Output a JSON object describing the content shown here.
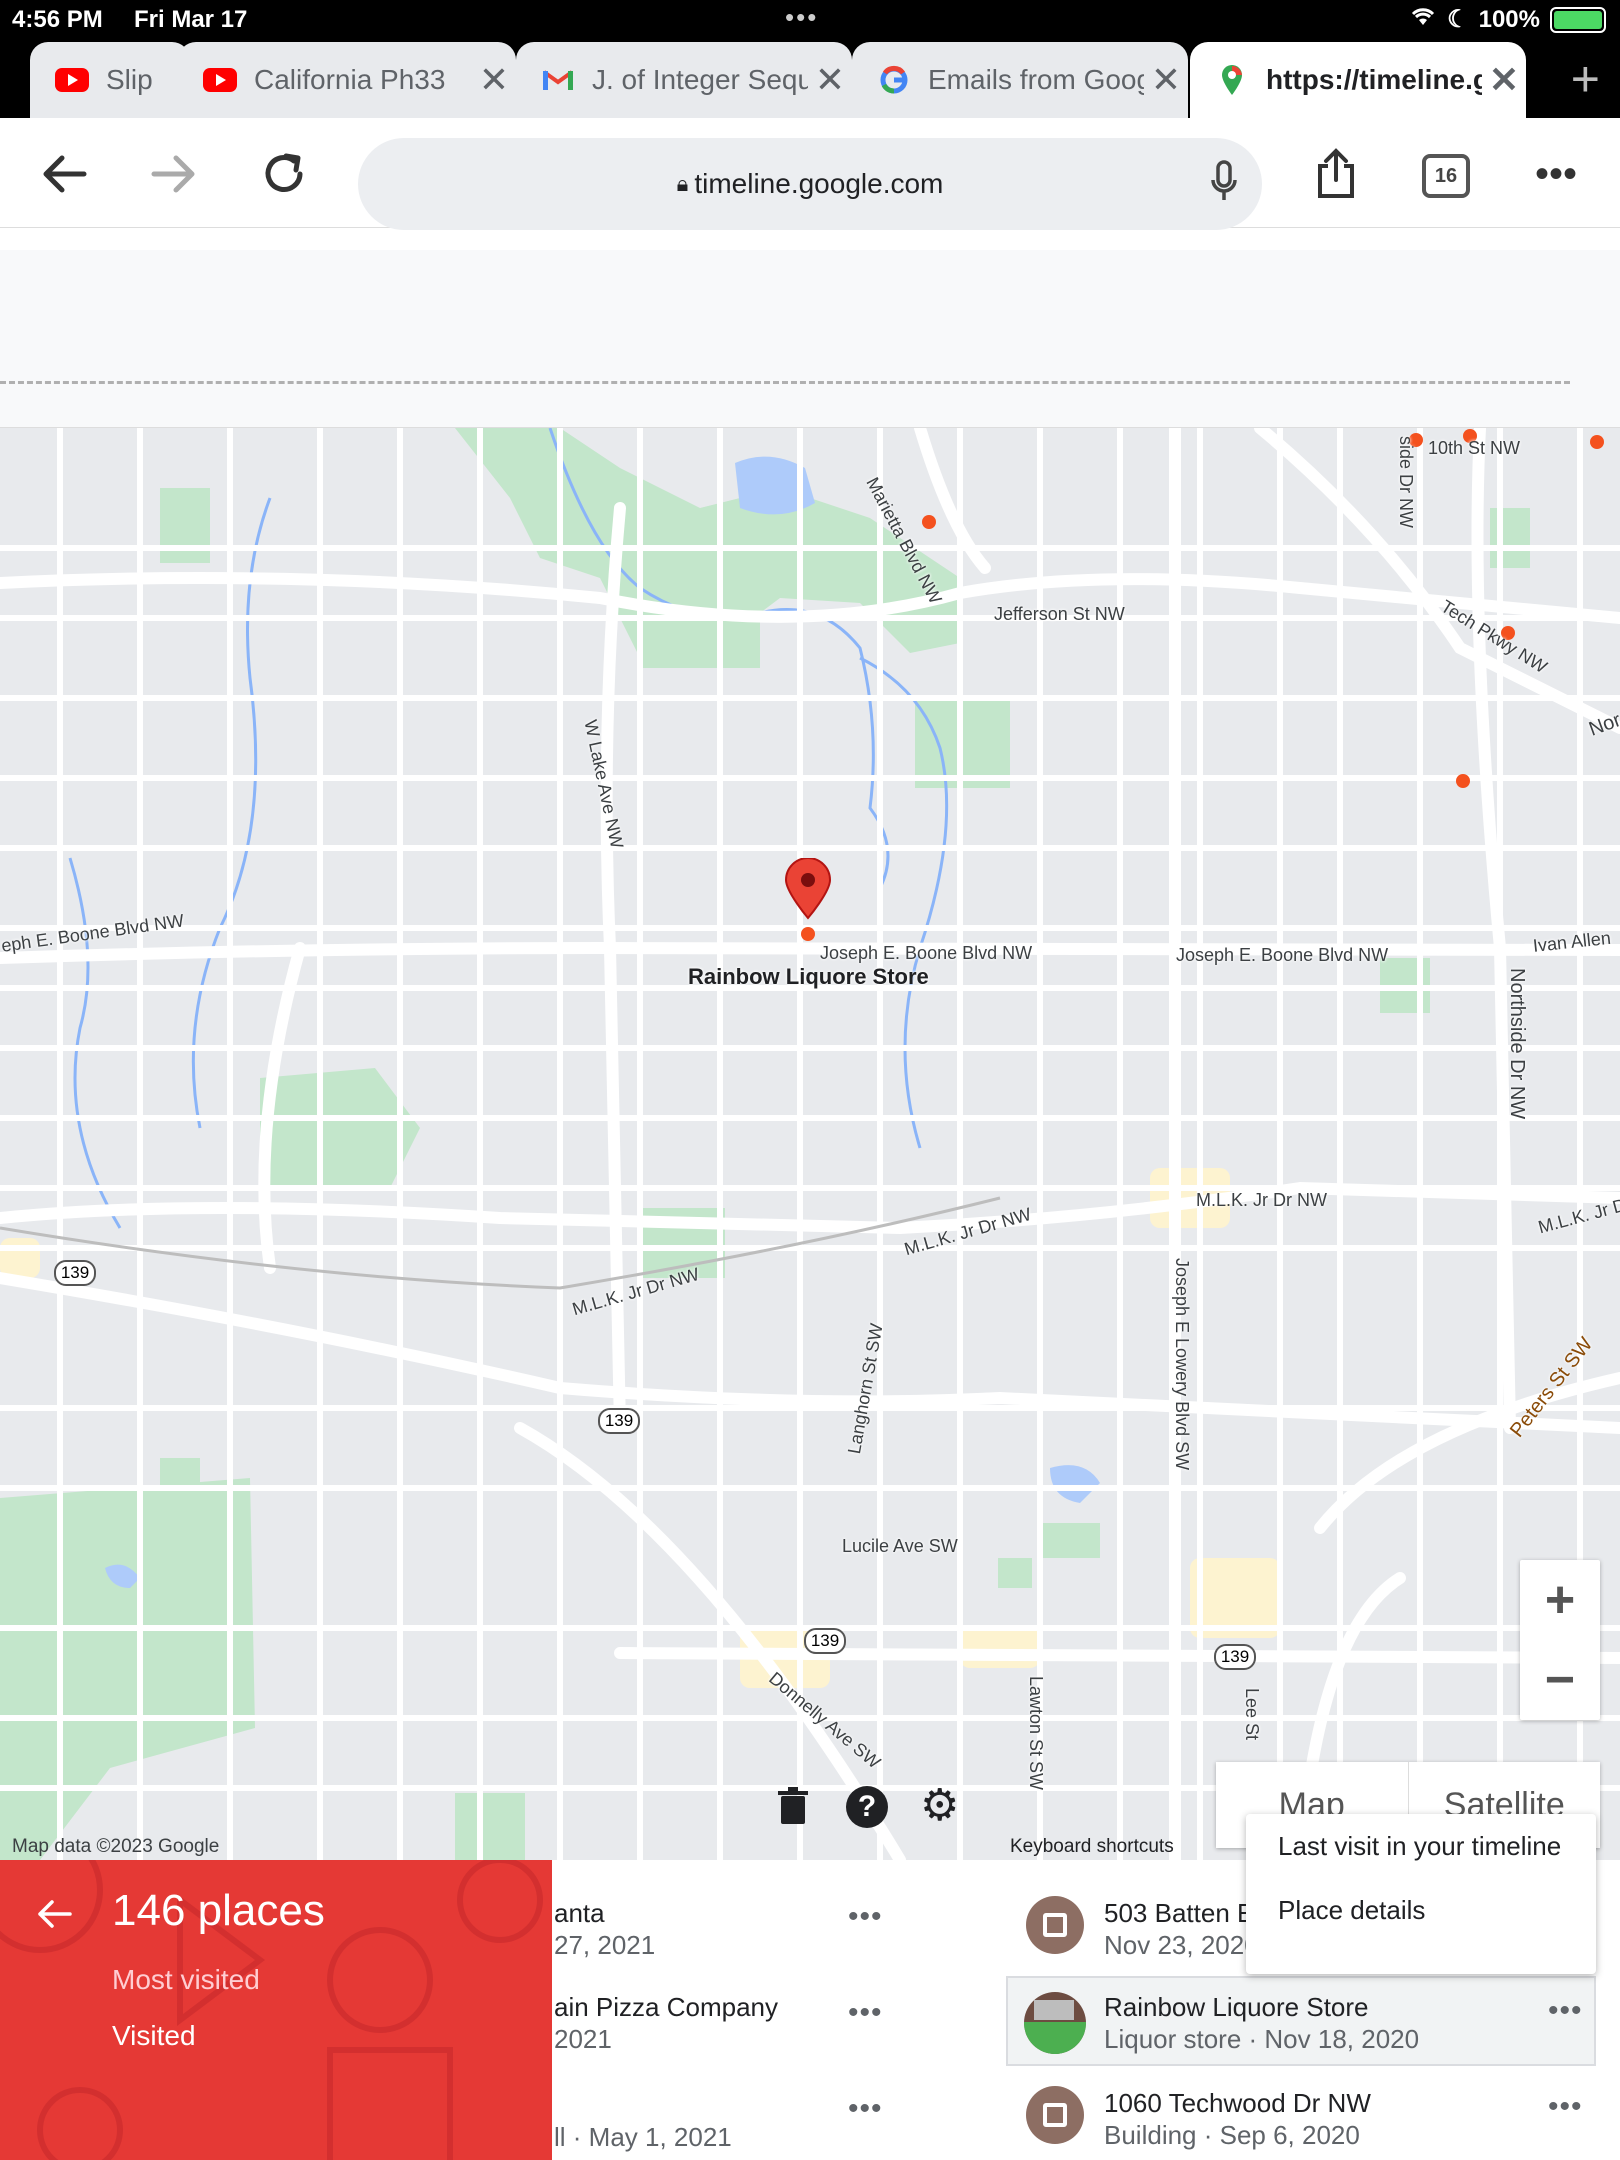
{
  "status_bar": {
    "time": "4:56 PM",
    "date": "Fri Mar 17",
    "battery": "100%"
  },
  "tabs": [
    {
      "title": "Slip",
      "icon": "youtube-icon"
    },
    {
      "title": "California Ph33",
      "icon": "youtube-icon"
    },
    {
      "title": "J. of Integer Sequences",
      "icon": "gmail-icon"
    },
    {
      "title": "Emails from Google",
      "icon": "google-icon"
    },
    {
      "title": "https://timeline.google.com",
      "icon": "maps-pin-icon"
    }
  ],
  "toolbar": {
    "url": "timeline.google.com",
    "tab_count": "16"
  },
  "map": {
    "selected_place": "Rainbow Liquore Store",
    "attribution": "Map data ©2023 Google",
    "keyboard_shortcuts": "Keyboard shortcuts",
    "map_type_map": "Map",
    "map_type_satellite": "Satellite",
    "zoom_in": "+",
    "zoom_out": "−",
    "streets": {
      "marietta": "Marietta Blvd NW",
      "jefferson": "Jefferson St NW",
      "tenth": "10th St NW",
      "tech_pkwy": "Tech Pkwy NW",
      "northside_top": "side Dr NW",
      "wlake": "W Lake Ave NW",
      "nor": "Nor",
      "boone_left": "eph E. Boone Blvd NW",
      "boone_mid": "Joseph E. Boone Blvd NW",
      "boone_right": "Joseph E. Boone Blvd NW",
      "ivan": "Ivan Allen",
      "northside_right": "Northside Dr NW",
      "mlk_right": "M.L.K. Jr Dr NW",
      "mlk_far": "M.L.K. Jr D",
      "mlk_mid": "M.L.K. Jr Dr NW",
      "mlk_left": "M.L.K. Jr Dr NW",
      "lowery": "Joseph E Lowery Blvd SW",
      "peters": "Peters St SW",
      "langhorn": "Langhorn St SW",
      "lucile": "Lucile Ave SW",
      "donnelly": "Donnelly Ave SW",
      "lawton": "Lawton St SW",
      "lee": "Lee St",
      "route": "139"
    }
  },
  "bottom_panel": {
    "places_count": "146 places",
    "filter_most_visited": "Most visited",
    "filter_visited": "Visited",
    "left_column": [
      {
        "title": "anta",
        "subtitle": "27, 2021"
      },
      {
        "title": "ain Pizza Company",
        "subtitle": "2021"
      },
      {
        "title": "",
        "subtitle": "ll · May 1, 2021"
      }
    ],
    "right_column": [
      {
        "title": "503 Batten E",
        "subtitle": "Nov 23, 2020"
      },
      {
        "title": "Rainbow Liquore Store",
        "subtitle": "Liquor store · Nov 18, 2020"
      },
      {
        "title": "1060 Techwood Dr NW",
        "subtitle": "Building · Sep 6, 2020"
      }
    ],
    "menu": {
      "item1": "Last visit in your timeline",
      "item2": "Place details"
    }
  }
}
